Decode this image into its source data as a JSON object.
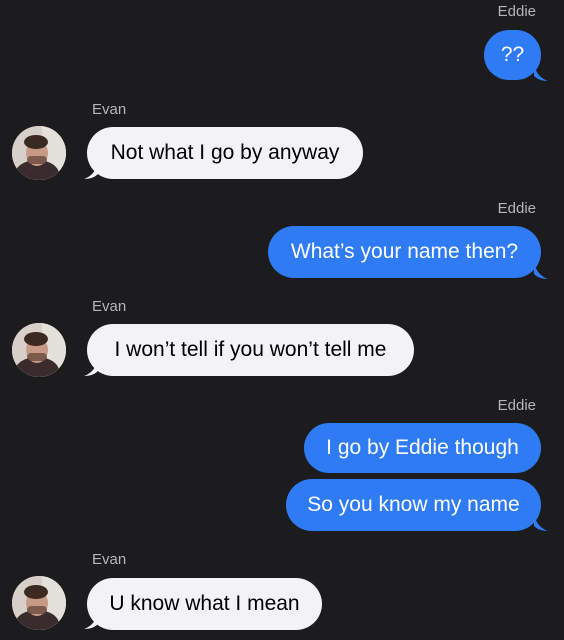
{
  "colors": {
    "background": "#1c1c1e",
    "incoming_bubble": "#f2f2f7",
    "outgoing_bubble": "#2f7bf4",
    "sender_label": "#b5b5ba"
  },
  "messages": [
    {
      "sender": "Eddie",
      "direction": "outgoing",
      "text": "??"
    },
    {
      "sender": "Evan",
      "direction": "incoming",
      "text": "Not what I go by anyway",
      "avatar": "contact-photo"
    },
    {
      "sender": "Eddie",
      "direction": "outgoing",
      "text": "What’s your name then?"
    },
    {
      "sender": "Evan",
      "direction": "incoming",
      "text": "I won’t tell if you won’t tell me",
      "avatar": "contact-photo"
    },
    {
      "sender": "Eddie",
      "direction": "outgoing",
      "text": "I go by Eddie though"
    },
    {
      "sender": "Eddie",
      "direction": "outgoing",
      "text": "So you know my name"
    },
    {
      "sender": "Evan",
      "direction": "incoming",
      "text": "U know what I mean",
      "avatar": "contact-photo"
    }
  ]
}
